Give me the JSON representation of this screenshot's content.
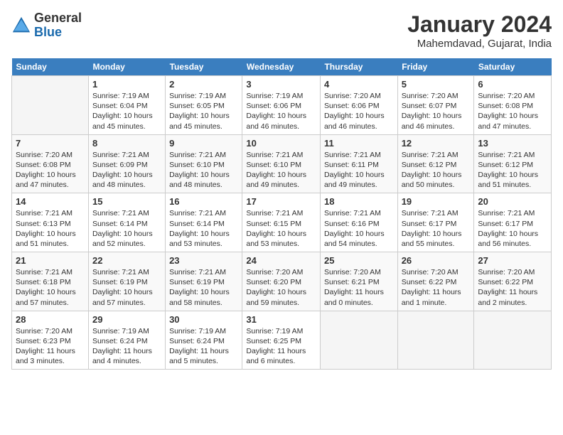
{
  "header": {
    "logo_general": "General",
    "logo_blue": "Blue",
    "month_title": "January 2024",
    "location": "Mahemdavad, Gujarat, India"
  },
  "days_of_week": [
    "Sunday",
    "Monday",
    "Tuesday",
    "Wednesday",
    "Thursday",
    "Friday",
    "Saturday"
  ],
  "weeks": [
    [
      {
        "day": "",
        "text": ""
      },
      {
        "day": "1",
        "text": "Sunrise: 7:19 AM\nSunset: 6:04 PM\nDaylight: 10 hours\nand 45 minutes."
      },
      {
        "day": "2",
        "text": "Sunrise: 7:19 AM\nSunset: 6:05 PM\nDaylight: 10 hours\nand 45 minutes."
      },
      {
        "day": "3",
        "text": "Sunrise: 7:19 AM\nSunset: 6:06 PM\nDaylight: 10 hours\nand 46 minutes."
      },
      {
        "day": "4",
        "text": "Sunrise: 7:20 AM\nSunset: 6:06 PM\nDaylight: 10 hours\nand 46 minutes."
      },
      {
        "day": "5",
        "text": "Sunrise: 7:20 AM\nSunset: 6:07 PM\nDaylight: 10 hours\nand 46 minutes."
      },
      {
        "day": "6",
        "text": "Sunrise: 7:20 AM\nSunset: 6:08 PM\nDaylight: 10 hours\nand 47 minutes."
      }
    ],
    [
      {
        "day": "7",
        "text": "Sunrise: 7:20 AM\nSunset: 6:08 PM\nDaylight: 10 hours\nand 47 minutes."
      },
      {
        "day": "8",
        "text": "Sunrise: 7:21 AM\nSunset: 6:09 PM\nDaylight: 10 hours\nand 48 minutes."
      },
      {
        "day": "9",
        "text": "Sunrise: 7:21 AM\nSunset: 6:10 PM\nDaylight: 10 hours\nand 48 minutes."
      },
      {
        "day": "10",
        "text": "Sunrise: 7:21 AM\nSunset: 6:10 PM\nDaylight: 10 hours\nand 49 minutes."
      },
      {
        "day": "11",
        "text": "Sunrise: 7:21 AM\nSunset: 6:11 PM\nDaylight: 10 hours\nand 49 minutes."
      },
      {
        "day": "12",
        "text": "Sunrise: 7:21 AM\nSunset: 6:12 PM\nDaylight: 10 hours\nand 50 minutes."
      },
      {
        "day": "13",
        "text": "Sunrise: 7:21 AM\nSunset: 6:12 PM\nDaylight: 10 hours\nand 51 minutes."
      }
    ],
    [
      {
        "day": "14",
        "text": "Sunrise: 7:21 AM\nSunset: 6:13 PM\nDaylight: 10 hours\nand 51 minutes."
      },
      {
        "day": "15",
        "text": "Sunrise: 7:21 AM\nSunset: 6:14 PM\nDaylight: 10 hours\nand 52 minutes."
      },
      {
        "day": "16",
        "text": "Sunrise: 7:21 AM\nSunset: 6:14 PM\nDaylight: 10 hours\nand 53 minutes."
      },
      {
        "day": "17",
        "text": "Sunrise: 7:21 AM\nSunset: 6:15 PM\nDaylight: 10 hours\nand 53 minutes."
      },
      {
        "day": "18",
        "text": "Sunrise: 7:21 AM\nSunset: 6:16 PM\nDaylight: 10 hours\nand 54 minutes."
      },
      {
        "day": "19",
        "text": "Sunrise: 7:21 AM\nSunset: 6:17 PM\nDaylight: 10 hours\nand 55 minutes."
      },
      {
        "day": "20",
        "text": "Sunrise: 7:21 AM\nSunset: 6:17 PM\nDaylight: 10 hours\nand 56 minutes."
      }
    ],
    [
      {
        "day": "21",
        "text": "Sunrise: 7:21 AM\nSunset: 6:18 PM\nDaylight: 10 hours\nand 57 minutes."
      },
      {
        "day": "22",
        "text": "Sunrise: 7:21 AM\nSunset: 6:19 PM\nDaylight: 10 hours\nand 57 minutes."
      },
      {
        "day": "23",
        "text": "Sunrise: 7:21 AM\nSunset: 6:19 PM\nDaylight: 10 hours\nand 58 minutes."
      },
      {
        "day": "24",
        "text": "Sunrise: 7:20 AM\nSunset: 6:20 PM\nDaylight: 10 hours\nand 59 minutes."
      },
      {
        "day": "25",
        "text": "Sunrise: 7:20 AM\nSunset: 6:21 PM\nDaylight: 11 hours\nand 0 minutes."
      },
      {
        "day": "26",
        "text": "Sunrise: 7:20 AM\nSunset: 6:22 PM\nDaylight: 11 hours\nand 1 minute."
      },
      {
        "day": "27",
        "text": "Sunrise: 7:20 AM\nSunset: 6:22 PM\nDaylight: 11 hours\nand 2 minutes."
      }
    ],
    [
      {
        "day": "28",
        "text": "Sunrise: 7:20 AM\nSunset: 6:23 PM\nDaylight: 11 hours\nand 3 minutes."
      },
      {
        "day": "29",
        "text": "Sunrise: 7:19 AM\nSunset: 6:24 PM\nDaylight: 11 hours\nand 4 minutes."
      },
      {
        "day": "30",
        "text": "Sunrise: 7:19 AM\nSunset: 6:24 PM\nDaylight: 11 hours\nand 5 minutes."
      },
      {
        "day": "31",
        "text": "Sunrise: 7:19 AM\nSunset: 6:25 PM\nDaylight: 11 hours\nand 6 minutes."
      },
      {
        "day": "",
        "text": ""
      },
      {
        "day": "",
        "text": ""
      },
      {
        "day": "",
        "text": ""
      }
    ]
  ]
}
